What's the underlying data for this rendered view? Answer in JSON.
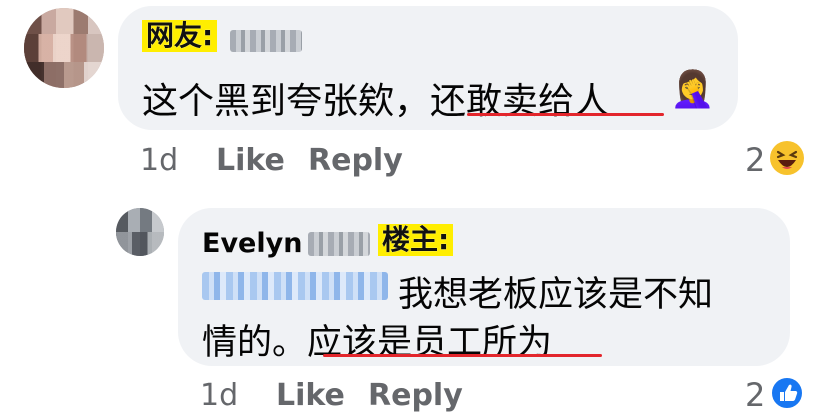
{
  "comment1": {
    "tag": "网友:",
    "text": "这个黑到夸张欸，还敢卖给人",
    "time": "1d",
    "like": "Like",
    "reply": "Reply",
    "reactions_count": "2",
    "reaction_icon": "haha-icon"
  },
  "comment2": {
    "author": "Evelyn",
    "tag": "楼主:",
    "text_line1": "我想老板应该是不知",
    "text_line2": "情的。应该是员工所为",
    "time": "1d",
    "like": "Like",
    "reply": "Reply",
    "reactions_count": "2",
    "reaction_icon": "like-icon"
  },
  "colors": {
    "bubble": "#f0f2f5",
    "sticker": "#ffee00",
    "underline": "#e3262c",
    "meta": "#65676b",
    "like_blue": "#1877f2"
  }
}
